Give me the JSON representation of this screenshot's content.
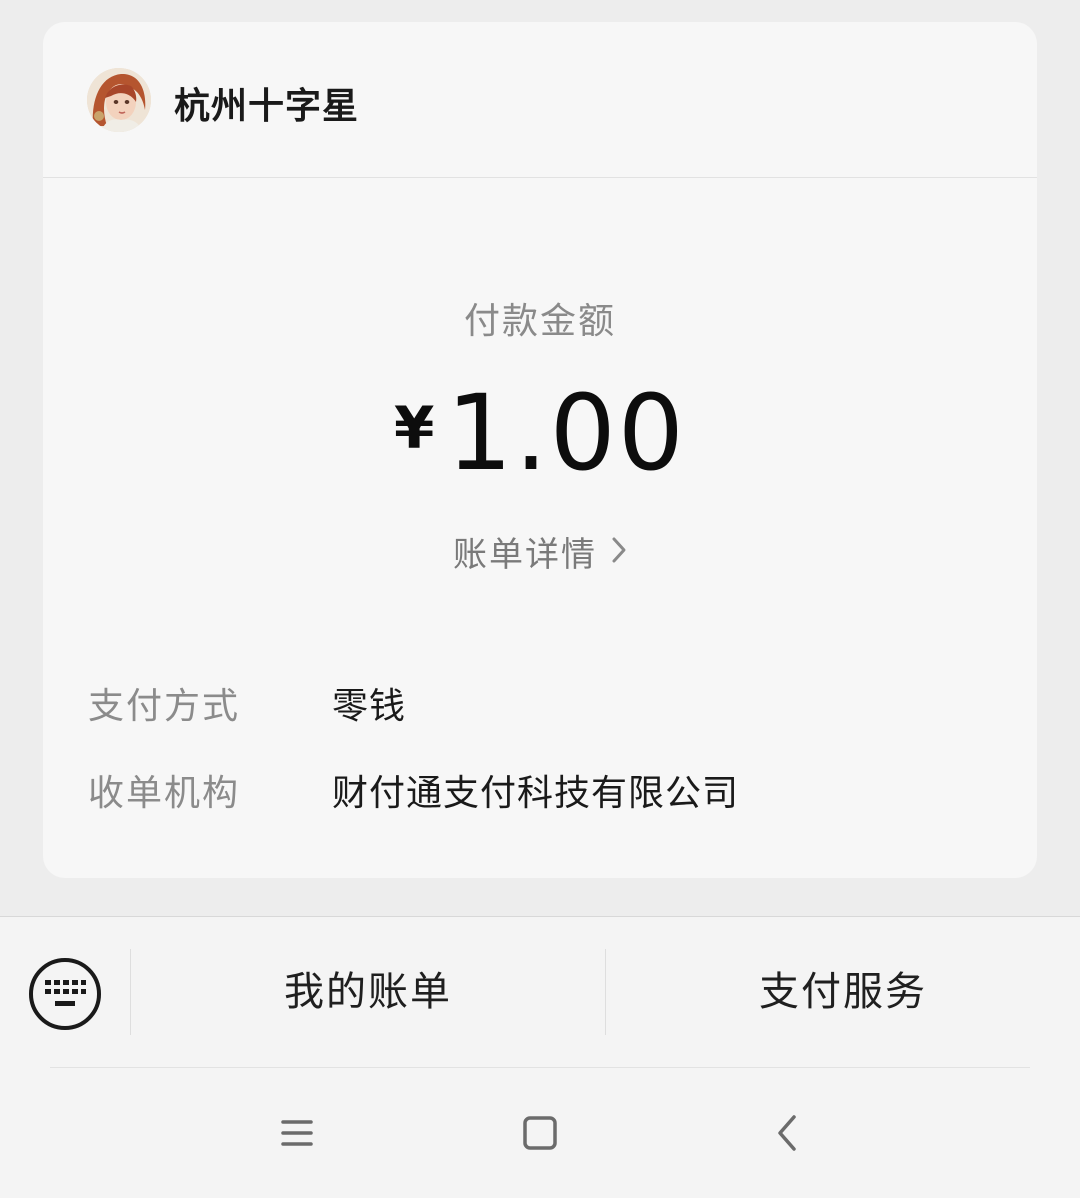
{
  "merchant": {
    "name": "杭州十字星"
  },
  "payment": {
    "amount_label": "付款金额",
    "currency_symbol": "¥",
    "amount": "1.00",
    "bill_detail_label": "账单详情"
  },
  "details": [
    {
      "label": "支付方式",
      "value": "零钱"
    },
    {
      "label": "收单机构",
      "value": "财付通支付科技有限公司"
    }
  ],
  "bottom_menu": {
    "keyboard_icon": "keyboard-icon",
    "my_bills_label": "我的账单",
    "pay_service_label": "支付服务"
  },
  "system_nav": {
    "menu_icon": "hamburger-icon",
    "home_icon": "square-icon",
    "back_icon": "chevron-left-icon"
  }
}
